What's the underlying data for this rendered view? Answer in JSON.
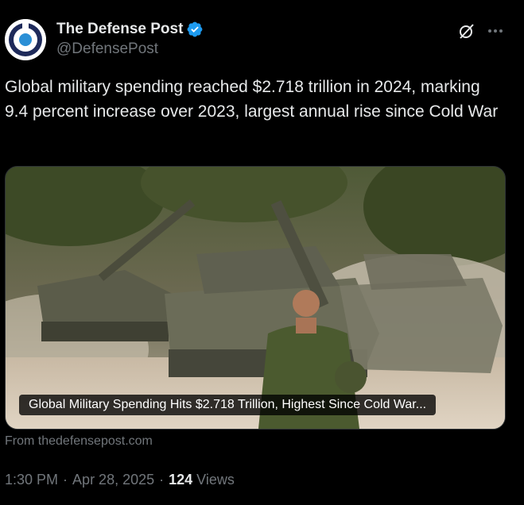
{
  "author": {
    "display_name": "The Defense Post",
    "handle": "@DefensePost",
    "verified": true,
    "avatar_colors": {
      "ring": "#1e2a5a",
      "dot": "#2a8fd6",
      "bg": "#ffffff"
    }
  },
  "tweet": {
    "text": "Global military spending reached $2.718 trillion in 2024, marking 9.4 percent increase over 2023, largest annual rise since Cold War"
  },
  "card": {
    "title": "Global Military Spending Hits $2.718 Trillion, Highest Since Cold War...",
    "source": "From thedefensepost.com",
    "image_icon": "tanks-photo"
  },
  "meta": {
    "time": "1:30 PM",
    "separator": "·",
    "date": "Apr 28, 2025",
    "views_count": "124",
    "views_label": "Views"
  },
  "colors": {
    "background": "#000000",
    "text_primary": "#e7e9ea",
    "text_secondary": "#71767b",
    "verified_badge": "#1d9bf0",
    "border": "#2f3336"
  },
  "icons": {
    "grok": "grok-icon",
    "more": "more-icon",
    "verified": "verified-badge-icon"
  }
}
